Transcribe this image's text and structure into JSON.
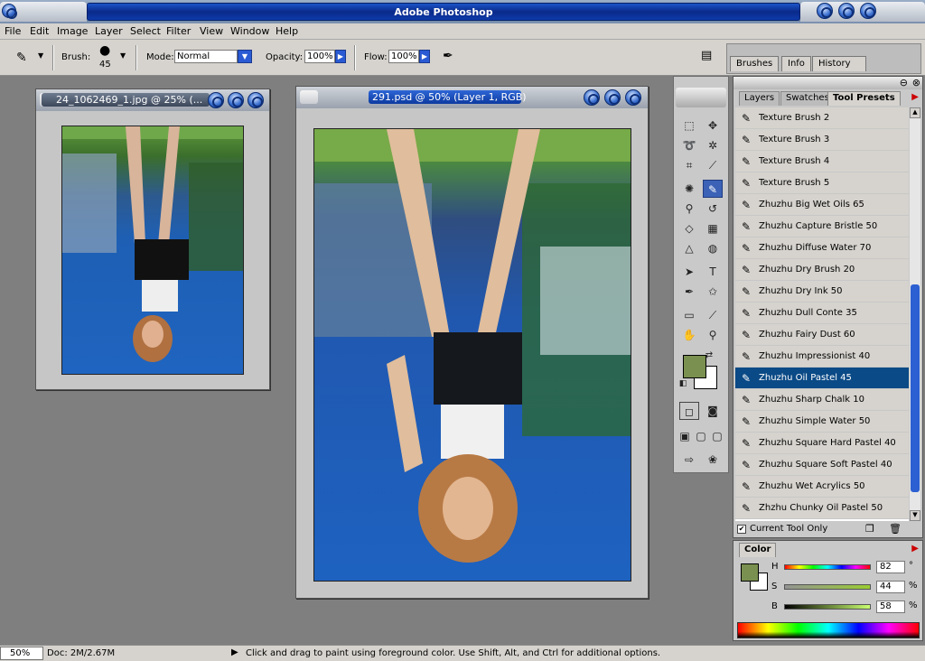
{
  "app": {
    "title": "Adobe Photoshop"
  },
  "menu": [
    "File",
    "Edit",
    "Image",
    "Layer",
    "Select",
    "Filter",
    "View",
    "Window",
    "Help"
  ],
  "options": {
    "brush_label": "Brush:",
    "brush_size": "45",
    "mode_label": "Mode:",
    "mode_value": "Normal",
    "opacity_label": "Opacity:",
    "opacity_value": "100%",
    "flow_label": "Flow:",
    "flow_value": "100%"
  },
  "dock_tabs": [
    "Brushes",
    "Info",
    "History"
  ],
  "documents": [
    {
      "name": "24_1062469_1.jpg @ 25% (..."
    },
    {
      "name": "291.psd @ 50% (Layer 1, RGB)"
    }
  ],
  "presets_panel": {
    "tabs": [
      "Layers",
      "Swatches",
      "Tool Presets"
    ],
    "items": [
      "Texture Brush 2",
      "Texture Brush 3",
      "Texture Brush 4",
      "Texture Brush 5",
      "Zhuzhu Big Wet Oils 65",
      "Zhuzhu Capture Bristle 50",
      "Zhuzhu Diffuse Water 70",
      "Zhuzhu Dry Brush 20",
      "Zhuzhu Dry Ink 50",
      "Zhuzhu Dull Conte 35",
      "Zhuzhu Fairy Dust 60",
      "Zhuzhu Impressionist 40",
      "Zhuzhu Oil Pastel 45",
      "Zhuzhu Sharp Chalk 10",
      "Zhuzhu Simple Water 50",
      "Zhuzhu Square Hard Pastel 40",
      "Zhuzhu Square Soft Pastel 40",
      "Zhuzhu Wet Acrylics 50",
      "Zhzhu Chunky Oil Pastel 50"
    ],
    "selected_index": 12,
    "current_tool_only": "Current Tool Only"
  },
  "color_panel": {
    "title": "Color",
    "h_label": "H",
    "h_value": "82",
    "h_unit": "°",
    "s_label": "S",
    "s_value": "44",
    "s_unit": "%",
    "b_label": "B",
    "b_value": "58",
    "b_unit": "%",
    "foreground": "#7a9050",
    "background": "#ffffff"
  },
  "status": {
    "zoom": "50%",
    "doc": "Doc: 2M/2.67M",
    "hint": "Click and drag to paint using foreground color.  Use Shift, Alt, and Ctrl for additional options."
  }
}
